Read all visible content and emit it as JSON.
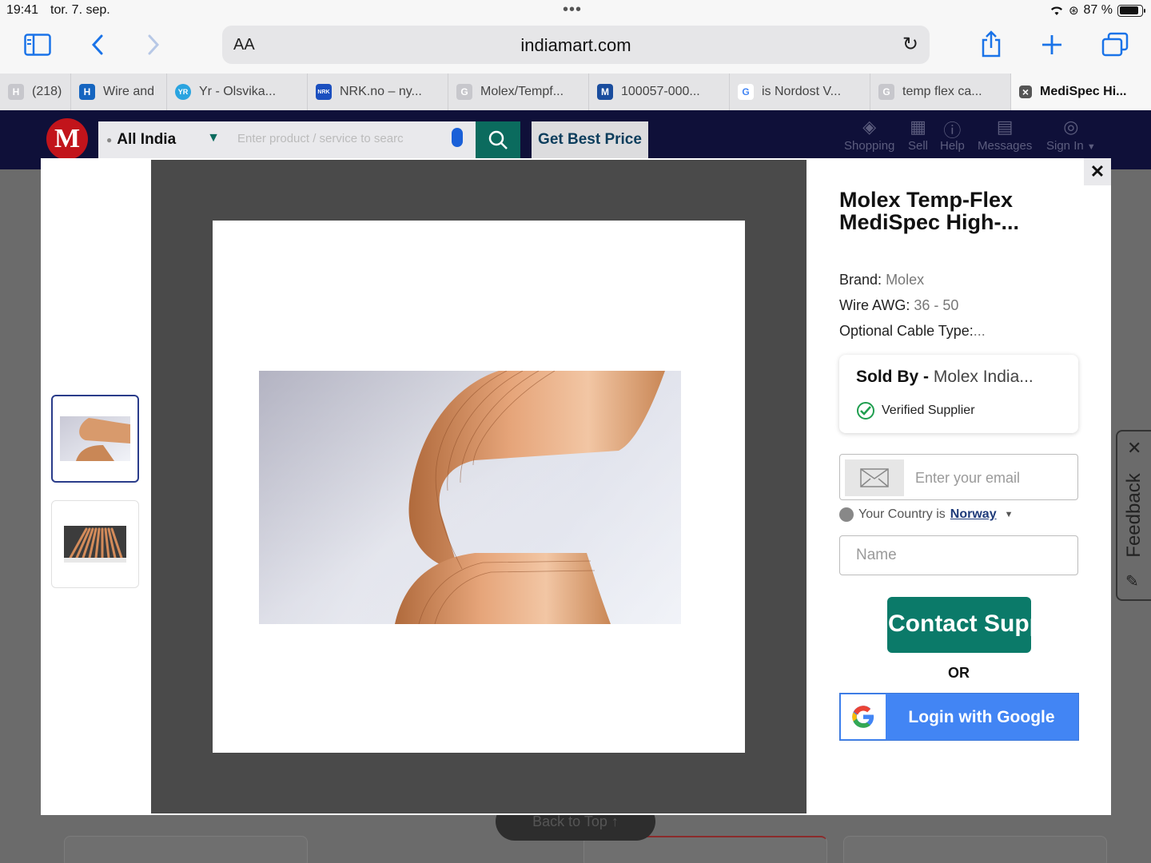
{
  "status_bar": {
    "time": "19:41",
    "date": "tor. 7. sep.",
    "battery": "87 %",
    "battery_level": 0.87
  },
  "address_bar": {
    "text_size": "AA",
    "url": "indiamart.com"
  },
  "tabs": [
    {
      "label": "(218)",
      "favicon": "H",
      "favicon_color": "#c7c7cc"
    },
    {
      "label": "Wire and",
      "favicon": "H",
      "favicon_color": "#1565c0"
    },
    {
      "label": "Yr - Olsvika...",
      "favicon": "YR",
      "favicon_color": "#2aa4e0"
    },
    {
      "label": "NRK.no – ny...",
      "favicon": "NRK",
      "favicon_color": "#1b4fbf"
    },
    {
      "label": "Molex/Tempf...",
      "favicon": "G",
      "favicon_color": "#c7c7cc"
    },
    {
      "label": "100057-000...",
      "favicon": "M",
      "favicon_color": "#1a4d9e"
    },
    {
      "label": "is Nordost V...",
      "favicon": "G",
      "favicon_color": "#ffffff"
    },
    {
      "label": "temp flex ca...",
      "favicon": "G",
      "favicon_color": "#c7c7cc"
    },
    {
      "label": "MediSpec Hi...",
      "favicon": "×",
      "favicon_color": "#555555",
      "active": true
    }
  ],
  "header": {
    "logo": "M",
    "location": "All India",
    "search_placeholder": "Enter product / service to searc",
    "best_price": "Get Best Price",
    "nav": [
      {
        "label": "Shopping",
        "icon": "tag-icon"
      },
      {
        "label": "Sell",
        "icon": "store-icon"
      },
      {
        "label": "Help",
        "icon": "help-icon"
      },
      {
        "label": "Messages",
        "icon": "messages-icon"
      },
      {
        "label": "Sign In",
        "icon": "user-icon"
      }
    ]
  },
  "modal": {
    "title": "Molex Temp-Flex MediSpec High-...",
    "specs": [
      {
        "label": "Brand:",
        "value": "Molex"
      },
      {
        "label": "Wire AWG:",
        "value": "36 - 50"
      },
      {
        "label": "Optional Cable Type:",
        "value": "..."
      }
    ],
    "sold_by_label": "Sold By -",
    "seller": "Molex India...",
    "verified": "Verified Supplier",
    "email_placeholder": "Enter your email",
    "country_prefix": "Your Country is",
    "country": "Norway",
    "name_placeholder": "Name",
    "contact_button": "Contact Supplier",
    "or_text": "OR",
    "google_button": "Login with Google"
  },
  "page": {
    "back_to_top": "Back to Top ↑"
  },
  "feedback": {
    "label": "Feedback"
  },
  "colors": {
    "header_bg": "#0f1039",
    "accent_green": "#0b7a69",
    "google_blue": "#4285f4"
  }
}
